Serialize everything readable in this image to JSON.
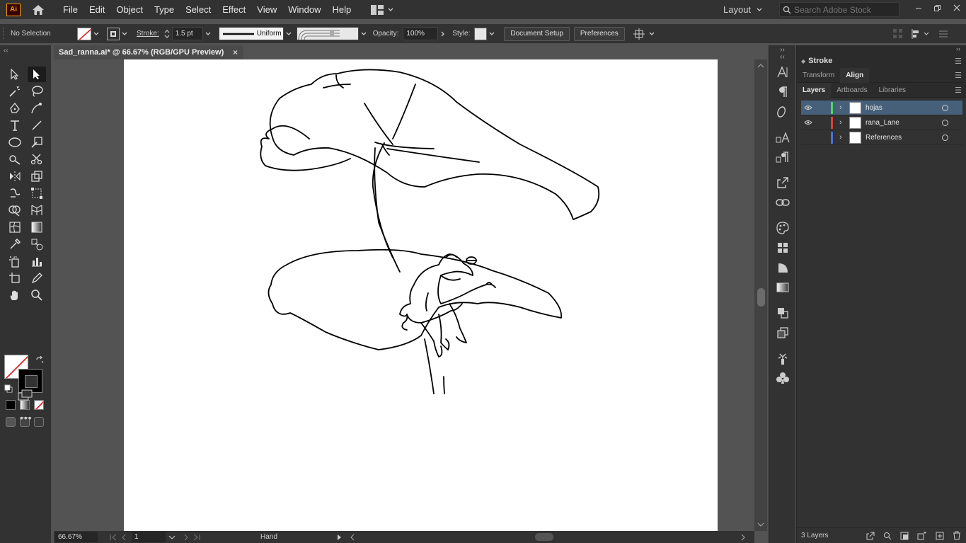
{
  "app": {
    "logo_text": "Ai",
    "menus": [
      "File",
      "Edit",
      "Object",
      "Type",
      "Select",
      "Effect",
      "View",
      "Window",
      "Help"
    ],
    "workspace": "Layout",
    "search_placeholder": "Search Adobe Stock"
  },
  "control": {
    "selection": "No Selection",
    "stroke_label": "Stroke:",
    "stroke_value": "1.5 pt",
    "profile": "Uniform",
    "opacity_label": "Opacity:",
    "opacity_value": "100%",
    "style_label": "Style:",
    "document_setup": "Document Setup",
    "preferences": "Preferences"
  },
  "document": {
    "tab_title": "Sad_ranna.ai* @ 66.67% (RGB/GPU Preview)",
    "close_glyph": "×"
  },
  "status": {
    "zoom": "66.67%",
    "artboard": "1",
    "tool": "Hand"
  },
  "panels": {
    "stroke_title": "Stroke",
    "tabs_top": [
      "Transform",
      "Align"
    ],
    "tabs_layers": [
      "Layers",
      "Artboards",
      "Libraries"
    ],
    "layers": [
      {
        "name": "hojas",
        "color": "#4cd964",
        "visible": true
      },
      {
        "name": "rana_Lane",
        "color": "#e0403a",
        "visible": true
      },
      {
        "name": "References",
        "color": "#4a6fe0",
        "visible": false
      }
    ],
    "layer_count": "3 Layers"
  },
  "colors": {
    "ui_dark": "#323232",
    "canvas": "#535353",
    "selected_layer": "#46607a",
    "accent_logo": "#ff9a00"
  }
}
